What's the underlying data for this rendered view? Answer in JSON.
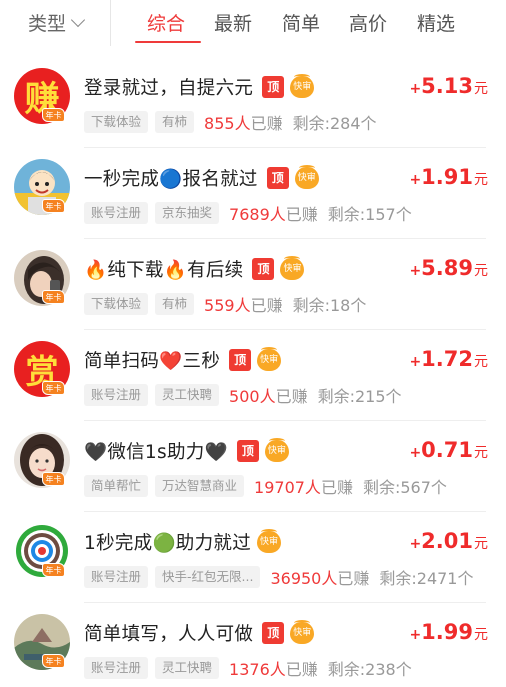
{
  "filter": {
    "type_label": "类型",
    "tabs": [
      "综合",
      "最新",
      "简单",
      "高价",
      "精选"
    ],
    "active_tab": "综合"
  },
  "badges": {
    "top": "顶",
    "fast_review": "快审",
    "year_card": "年卡"
  },
  "tasks": [
    {
      "avatar_text": "赚",
      "title": "登录就过，自提六元",
      "show_top_badge": true,
      "price_sign": "+",
      "price": "5.13",
      "unit": "元",
      "tags": [
        "下载体验",
        "有柿"
      ],
      "count": "855人",
      "count_suffix": "已赚",
      "remaining": "剩余:284个"
    },
    {
      "avatar_text": "",
      "title": "一秒完成🔵报名就过",
      "show_top_badge": true,
      "price_sign": "+",
      "price": "1.91",
      "unit": "元",
      "tags": [
        "账号注册",
        "京东抽奖"
      ],
      "count": "7689人",
      "count_suffix": "已赚",
      "remaining": "剩余:157个"
    },
    {
      "avatar_text": "",
      "title": "🔥纯下载🔥有后续",
      "show_top_badge": true,
      "price_sign": "+",
      "price": "5.89",
      "unit": "元",
      "tags": [
        "下载体验",
        "有柿"
      ],
      "count": "559人",
      "count_suffix": "已赚",
      "remaining": "剩余:18个"
    },
    {
      "avatar_text": "赏",
      "title": "简单扫码❤️三秒",
      "show_top_badge": true,
      "price_sign": "+",
      "price": "1.72",
      "unit": "元",
      "tags": [
        "账号注册",
        "灵工快聘"
      ],
      "count": "500人",
      "count_suffix": "已赚",
      "remaining": "剩余:215个"
    },
    {
      "avatar_text": "",
      "title": "🖤微信1s助力🖤",
      "show_top_badge": true,
      "price_sign": "+",
      "price": "0.71",
      "unit": "元",
      "tags": [
        "简单帮忙",
        "万达智慧商业"
      ],
      "count": "19707人",
      "count_suffix": "已赚",
      "remaining": "剩余:567个"
    },
    {
      "avatar_text": "",
      "title": "1秒完成🟢助力就过",
      "show_top_badge": false,
      "price_sign": "+",
      "price": "2.01",
      "unit": "元",
      "tags": [
        "账号注册",
        "快手-红包无限..."
      ],
      "count": "36950人",
      "count_suffix": "已赚",
      "remaining": "剩余:2471个"
    },
    {
      "avatar_text": "",
      "title": "简单填写，人人可做",
      "show_top_badge": true,
      "price_sign": "+",
      "price": "1.99",
      "unit": "元",
      "tags": [
        "账号注册",
        "灵工快聘"
      ],
      "count": "1376人",
      "count_suffix": "已赚",
      "remaining": "剩余:238个"
    }
  ]
}
